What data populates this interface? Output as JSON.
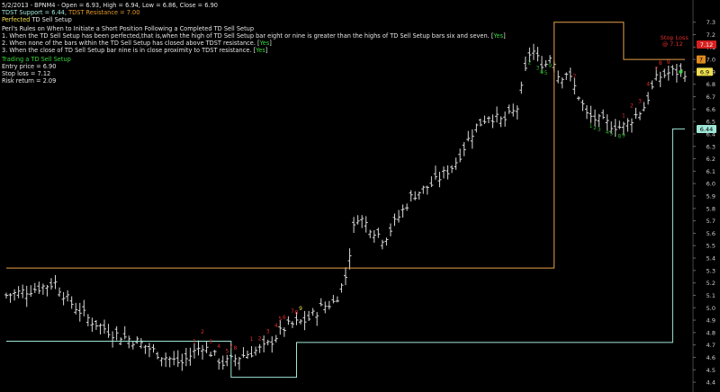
{
  "header": {
    "title_line": "5/2/2013 - BPNM4 -  Open = 6.93, High = 6.94, Low = 6.86, Close = 6.90",
    "support_label": "TDST Support = 6.44,",
    "resistance_label": "TDST Resistance = 7.00",
    "perfected_label": "Perfected",
    "perfected_rest": " TD Sell Setup"
  },
  "rules": {
    "title": "Perl's Rules on When to Initiate a Short Position Following a Completed TD Sell Setup",
    "items": [
      {
        "text": "1. When the TD Sell Setup has been perfected,that is,when the high of TD Sell Setup bar eight or nine is greater than the highs of TD Sell Setup bars six and seven. [",
        "flag": "Yes",
        "close": "]"
      },
      {
        "text": "2. When none of the bars within the TD Sell Setup has closed above TDST resistance. [",
        "flag": "Yes",
        "close": "]"
      },
      {
        "text": "3. When the close of TD Sell Setup bar nine is in close proximity to TDST resistance. [",
        "flag": "Yes",
        "close": "]"
      }
    ]
  },
  "trade": {
    "title": "Trading a TD Sell Setup",
    "entry": "Entry price = 6.90",
    "stop": "Stop loss = 7.12",
    "risk_return": "Risk return = 2.09"
  },
  "chart_data": {
    "type": "ohlc",
    "ylim": [
      4.35,
      7.45
    ],
    "y_ticks": [
      4.4,
      4.5,
      4.6,
      4.7,
      4.8,
      4.9,
      5.0,
      5.1,
      5.2,
      5.3,
      5.4,
      5.5,
      5.6,
      5.7,
      5.8,
      5.9,
      6.0,
      6.1,
      6.2,
      6.3,
      6.4,
      6.5,
      6.6,
      6.7,
      6.8,
      6.9,
      7.0,
      7.1,
      7.2,
      7.3
    ],
    "bar_count": 167,
    "price_path": [
      [
        0,
        5.1
      ],
      [
        8,
        5.15
      ],
      [
        14,
        5.2
      ],
      [
        18,
        5.05
      ],
      [
        24,
        4.9
      ],
      [
        30,
        4.8
      ],
      [
        38,
        4.72
      ],
      [
        44,
        4.62
      ],
      [
        50,
        4.55
      ],
      [
        56,
        4.7
      ],
      [
        62,
        4.55
      ],
      [
        68,
        4.62
      ],
      [
        74,
        4.68
      ],
      [
        80,
        4.85
      ],
      [
        86,
        4.9
      ],
      [
        90,
        5.0
      ],
      [
        94,
        5.05
      ],
      [
        97,
        5.25
      ],
      [
        100,
        5.75
      ],
      [
        104,
        5.65
      ],
      [
        108,
        5.55
      ],
      [
        116,
        5.9
      ],
      [
        122,
        6.0
      ],
      [
        128,
        6.15
      ],
      [
        134,
        6.45
      ],
      [
        138,
        6.55
      ],
      [
        142,
        6.5
      ],
      [
        146,
        6.6
      ],
      [
        148,
        6.85
      ],
      [
        150,
        7.1
      ],
      [
        152,
        7.0
      ],
      [
        154,
        6.95
      ],
      [
        156,
        7.05
      ],
      [
        158,
        6.85
      ],
      [
        160,
        6.9
      ],
      [
        163,
        6.75
      ],
      [
        166,
        6.55
      ],
      [
        170,
        6.5
      ],
      [
        176,
        6.45
      ],
      [
        182,
        6.6
      ],
      [
        186,
        6.85
      ],
      [
        190,
        6.9
      ],
      [
        194,
        6.9
      ]
    ],
    "tdst_resistance": [
      [
        0,
        5.32
      ],
      [
        134,
        5.32
      ],
      [
        134,
        7.3
      ],
      [
        151,
        7.3
      ],
      [
        151,
        7.0
      ],
      [
        166,
        7.0
      ]
    ],
    "tdst_support": [
      [
        0,
        4.73
      ],
      [
        55,
        4.73
      ],
      [
        55,
        4.44
      ],
      [
        71,
        4.44
      ],
      [
        71,
        4.72
      ],
      [
        163,
        4.72
      ],
      [
        163,
        6.44
      ],
      [
        166,
        6.44
      ]
    ],
    "setup_counts": [
      {
        "bar": 46,
        "label": "1",
        "color": "red"
      },
      {
        "bar": 48,
        "label": "2",
        "color": "red"
      },
      {
        "bar": 50,
        "label": "3",
        "color": "red"
      },
      {
        "bar": 52,
        "label": "4",
        "color": "red"
      },
      {
        "bar": 54,
        "label": "5",
        "color": "red"
      },
      {
        "bar": 55,
        "label": "7",
        "color": "red"
      },
      {
        "bar": 56,
        "label": "8",
        "color": "red"
      },
      {
        "bar": 60,
        "label": "1",
        "color": "red"
      },
      {
        "bar": 62,
        "label": "2",
        "color": "red"
      },
      {
        "bar": 64,
        "label": "3",
        "color": "red"
      },
      {
        "bar": 66,
        "label": "4",
        "color": "red"
      },
      {
        "bar": 67,
        "label": "5",
        "color": "red"
      },
      {
        "bar": 68,
        "label": "6",
        "color": "red"
      },
      {
        "bar": 70,
        "label": "7",
        "color": "red"
      },
      {
        "bar": 71,
        "label": "8",
        "color": "red"
      },
      {
        "bar": 72,
        "label": "9",
        "color": "yellow"
      },
      {
        "bar": 128,
        "label": "2",
        "color": "green"
      },
      {
        "bar": 130,
        "label": "3",
        "color": "green"
      },
      {
        "bar": 131,
        "label": "4",
        "color": "green"
      },
      {
        "bar": 132,
        "label": "5",
        "color": "green"
      },
      {
        "bar": 131,
        "label": "8",
        "color": "green"
      },
      {
        "bar": 133,
        "label": "9",
        "color": "green"
      },
      {
        "bar": 139,
        "label": "7",
        "color": "red"
      },
      {
        "bar": 143,
        "label": "1",
        "color": "green"
      },
      {
        "bar": 144,
        "label": "2",
        "color": "green"
      },
      {
        "bar": 145,
        "label": "3",
        "color": "green"
      },
      {
        "bar": 147,
        "label": "4",
        "color": "green"
      },
      {
        "bar": 148,
        "label": "5",
        "color": "green"
      },
      {
        "bar": 150,
        "label": "8",
        "color": "green"
      },
      {
        "bar": 151,
        "label": "9",
        "color": "green"
      },
      {
        "bar": 151,
        "label": "1",
        "color": "red"
      },
      {
        "bar": 153,
        "label": "2",
        "color": "red"
      },
      {
        "bar": 155,
        "label": "3",
        "color": "red"
      },
      {
        "bar": 157,
        "label": "4",
        "color": "red"
      },
      {
        "bar": 159,
        "label": "7",
        "color": "red"
      },
      {
        "bar": 160,
        "label": "8",
        "color": "red"
      },
      {
        "bar": 162,
        "label": "9",
        "color": "red"
      }
    ],
    "stop_loss_annotation": {
      "label": "Stop Loss",
      "value": "@ 7.12"
    },
    "axis_badges": [
      {
        "text": "7.12",
        "color": "#d42020",
        "text_color": "#ffffff",
        "value": 7.12
      },
      {
        "text": "7",
        "color": "#e08a1e",
        "text_color": "#000000",
        "value": 7.0
      },
      {
        "text": "6.9",
        "color": "#f0e050",
        "text_color": "#000000",
        "value": 6.9
      },
      {
        "text": "6.44",
        "color": "#9fe7d8",
        "text_color": "#000000",
        "value": 6.44
      }
    ],
    "colors": {
      "background": "#000000",
      "bars": "#d8d8d8",
      "resistance": "#e8a04a",
      "support": "#9fe7d8",
      "grid": "#333333",
      "axis_text": "#cfcfcf",
      "count_red": "#e02c2c",
      "count_green": "#2fb02f",
      "count_yellow": "#f0e050"
    }
  }
}
